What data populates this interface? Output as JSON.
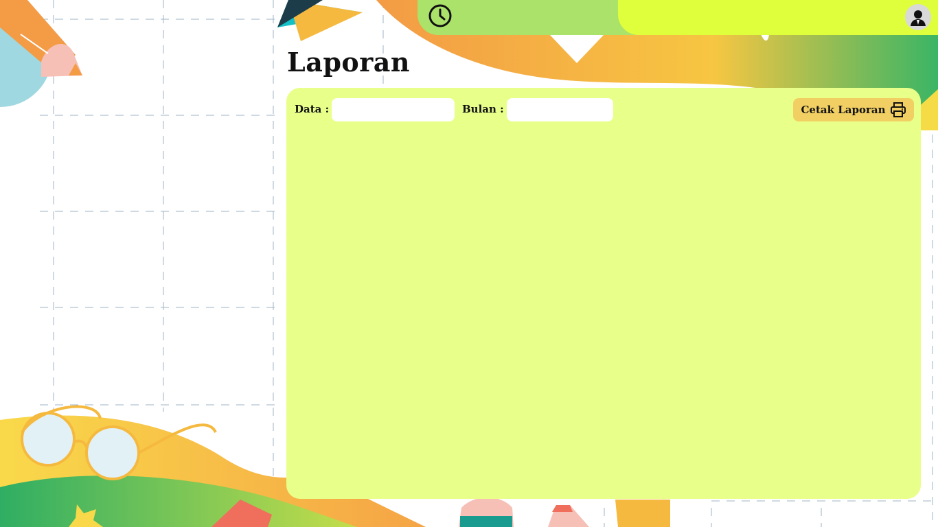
{
  "page": {
    "title": "Laporan"
  },
  "topbar": {
    "clock_icon": "clock-icon",
    "avatar_icon": "user-avatar-icon",
    "accent_left": "#abe26a",
    "accent_right": "#dfff3c"
  },
  "filters": {
    "data_label": "Data :",
    "data_value": "",
    "bulan_label": "Bulan :",
    "bulan_value": ""
  },
  "actions": {
    "print_label": "Cetak Laporan",
    "print_icon": "printer-icon",
    "print_color": "#f2cf63"
  },
  "panel": {
    "background": "#e8ff8a"
  }
}
